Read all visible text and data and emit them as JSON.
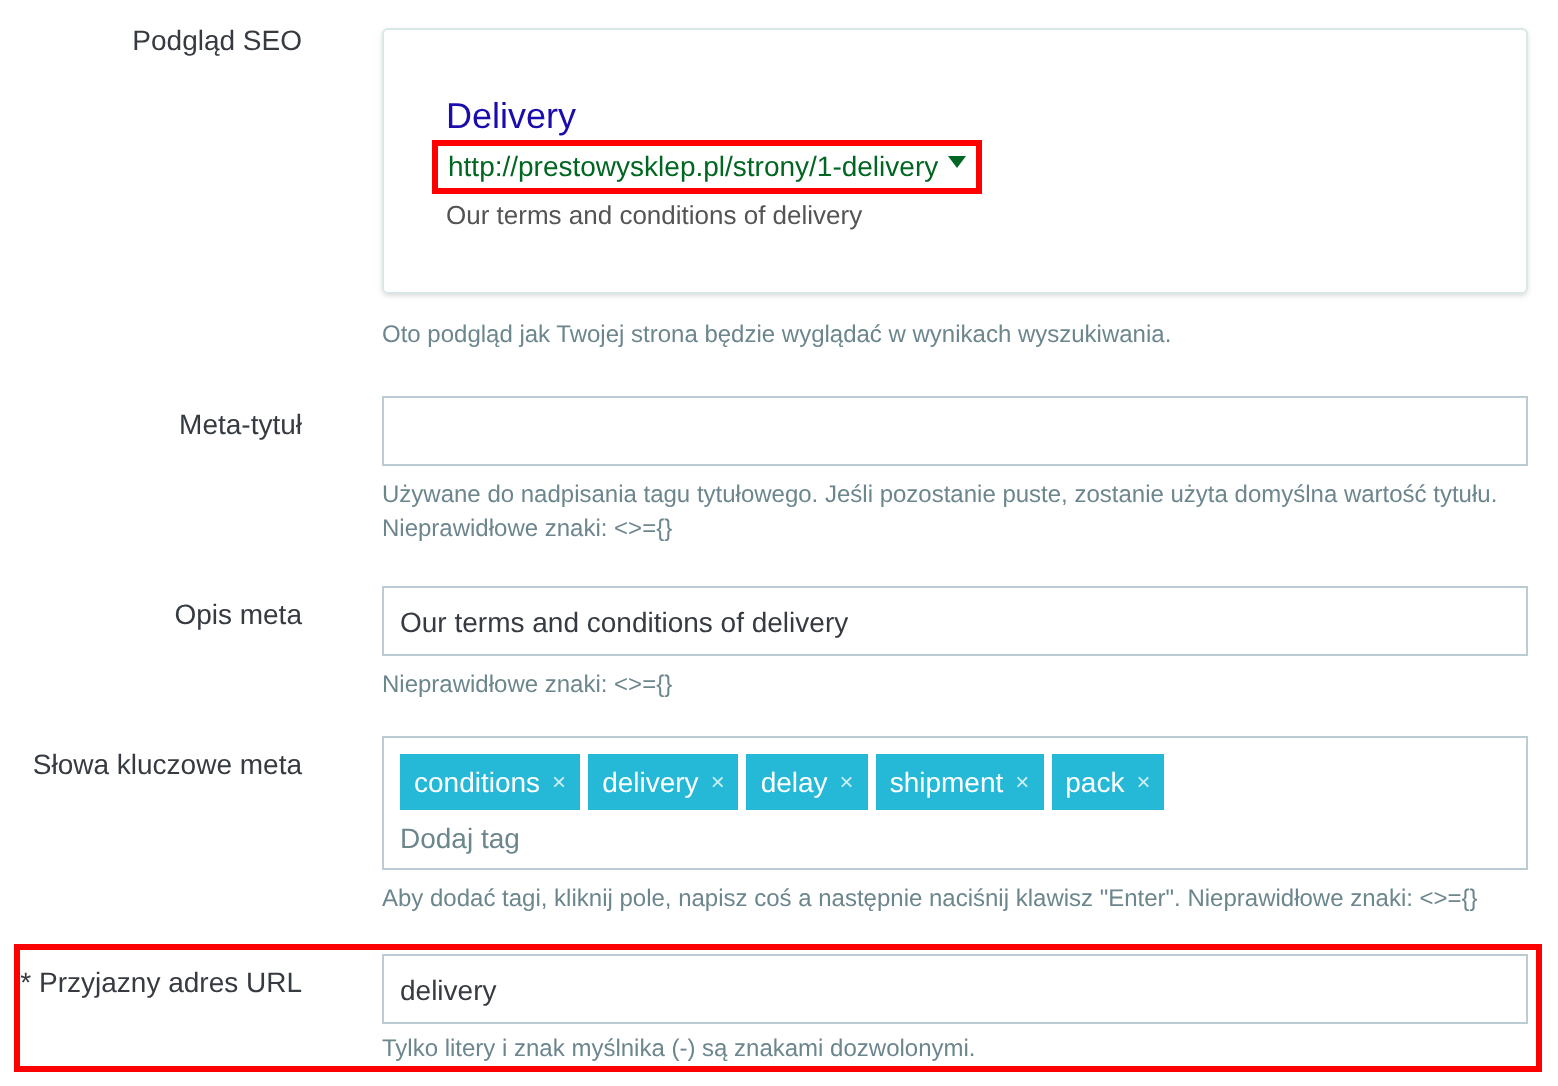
{
  "seo_preview": {
    "label": "Podgląd SEO",
    "title": "Delivery",
    "url": "http://prestowysklep.pl/strony/1-delivery",
    "url_highlighted": true,
    "description": "Our terms and conditions of delivery",
    "hint": "Oto podgląd jak Twojej strona będzie wyglądać w wynikach wyszukiwania."
  },
  "fields": [
    {
      "kind": "text",
      "label": "Meta-tytuł",
      "highlighted": false,
      "hint": "Używane do nadpisania tagu tytułowego. Jeśli pozostanie puste, zostanie użyta domyślna wartość tytułu. Nieprawidłowe znaki: <>={}"
    },
    {
      "kind": "text",
      "label": "Opis meta",
      "highlighted": false,
      "value": "Our terms and conditions of delivery",
      "hint": "Nieprawidłowe znaki: <>={}"
    },
    {
      "kind": "tags",
      "label": "Słowa kluczowe meta",
      "highlighted": false,
      "tags": [
        {
          "label": "conditions",
          "remove": "×"
        },
        {
          "label": "delivery",
          "remove": "×"
        },
        {
          "label": "delay",
          "remove": "×"
        },
        {
          "label": "shipment",
          "remove": "×"
        },
        {
          "label": "pack",
          "remove": "×"
        }
      ],
      "placeholder": "Dodaj tag",
      "hint": "Aby dodać tagi, kliknij pole, napisz coś a następnie naciśnij klawisz \"Enter\". Nieprawidłowe znaki: <>={}"
    },
    {
      "kind": "text",
      "label": "* Przyjazny adres URL",
      "highlighted": true,
      "value": "delivery",
      "hint": "Tylko litery i znak myślnika (-) są znakami dozwolonymi."
    }
  ]
}
